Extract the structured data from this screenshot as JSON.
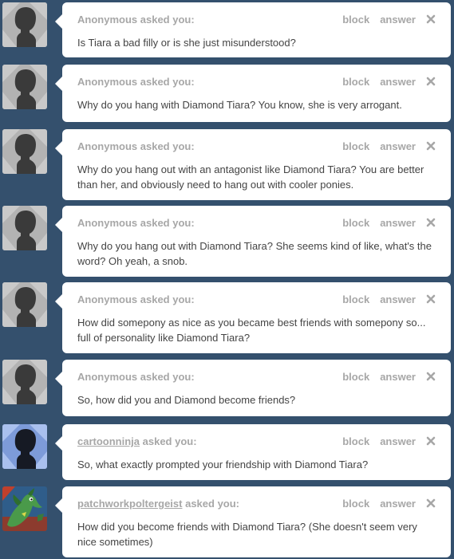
{
  "labels": {
    "asked_you": "asked you:",
    "block": "block",
    "answer": "answer"
  },
  "asks": [
    {
      "asker": "Anonymous",
      "asker_is_link": false,
      "avatar": "anonymous-silhouette",
      "question": "Is Tiara a bad filly or is she just misunderstood?"
    },
    {
      "asker": "Anonymous",
      "asker_is_link": false,
      "avatar": "anonymous-silhouette",
      "question": "Why do you hang with Diamond Tiara? You know, she is very arrogant."
    },
    {
      "asker": "Anonymous",
      "asker_is_link": false,
      "avatar": "anonymous-silhouette",
      "question": "Why do you hang out with an antagonist like Diamond Tiara? You are better than her, and obviously need to hang out with cooler ponies."
    },
    {
      "asker": "Anonymous",
      "asker_is_link": false,
      "avatar": "anonymous-silhouette",
      "question": "Why do you hang out with Diamond Tiara? She seems kind of like, what's the word? Oh yeah, a snob."
    },
    {
      "asker": "Anonymous",
      "asker_is_link": false,
      "avatar": "anonymous-silhouette",
      "question": "How did somepony as nice as you became best friends with somepony so... full of personality like Diamond Tiara?"
    },
    {
      "asker": "Anonymous",
      "asker_is_link": false,
      "avatar": "anonymous-silhouette",
      "question": "So, how did you and Diamond become friends?"
    },
    {
      "asker": "cartoonninja",
      "asker_is_link": true,
      "avatar": "user-silhouette-blue",
      "question": "So, what exactly prompted your friendship with Diamond Tiara?"
    },
    {
      "asker": "patchworkpoltergeist",
      "asker_is_link": true,
      "avatar": "user-art-green-pony",
      "question": "How did you become friends with Diamond Tiara? (She doesn't seem very nice sometimes)"
    }
  ],
  "colors": {
    "background": "#34506d",
    "card": "#ffffff",
    "muted_text": "#a7a7a7",
    "body_text": "#444444"
  }
}
